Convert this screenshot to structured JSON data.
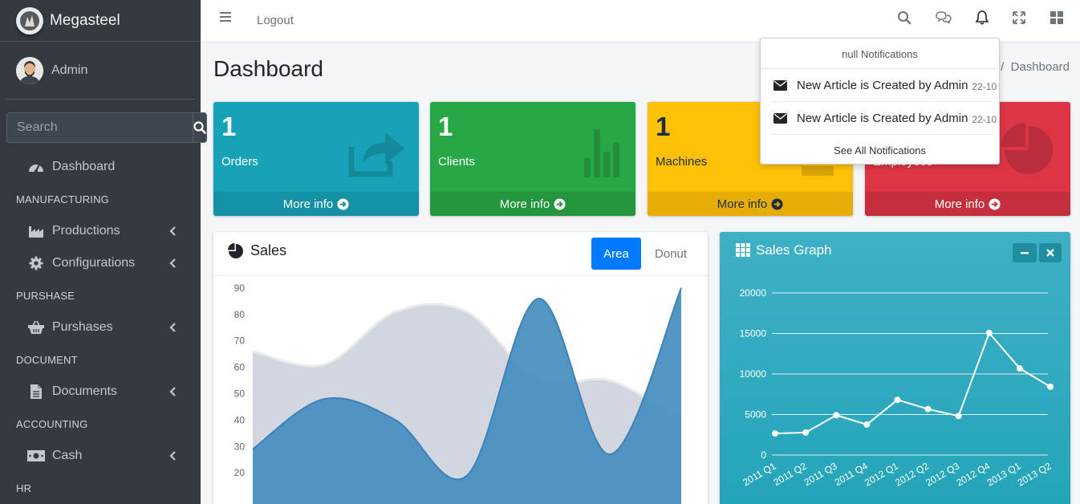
{
  "brand": {
    "name": "Megasteel"
  },
  "user": {
    "name": "Admin"
  },
  "sidebar": {
    "search_placeholder": "Search",
    "items": [
      {
        "type": "item",
        "label": "Dashboard",
        "icon": "tachometer-icon",
        "has_children": false
      },
      {
        "type": "header",
        "label": "MANUFACTURING"
      },
      {
        "type": "item",
        "label": "Productions",
        "icon": "industry-icon",
        "has_children": true
      },
      {
        "type": "item",
        "label": "Configurations",
        "icon": "gear-icon",
        "has_children": true
      },
      {
        "type": "header",
        "label": "PURSHASE"
      },
      {
        "type": "item",
        "label": "Purshases",
        "icon": "basket-icon",
        "has_children": true
      },
      {
        "type": "header",
        "label": "DOCUMENT"
      },
      {
        "type": "item",
        "label": "Documents",
        "icon": "file-icon",
        "has_children": true
      },
      {
        "type": "header",
        "label": "ACCOUNTING"
      },
      {
        "type": "item",
        "label": "Cash",
        "icon": "money-icon",
        "has_children": true
      },
      {
        "type": "header",
        "label": "HR"
      }
    ]
  },
  "topbar": {
    "logout_label": "Logout",
    "icons": [
      "menu-icon",
      "search-icon",
      "chat-icon",
      "bell-icon",
      "expand-icon",
      "apps-icon"
    ]
  },
  "page": {
    "title": "Dashboard",
    "breadcrumb": [
      "/",
      "Dashboard"
    ]
  },
  "notifications": {
    "header": "null Notifications",
    "items": [
      {
        "text": "New Article is Created by Admin",
        "time": "22-10",
        "icon": "envelope-icon"
      },
      {
        "text": "New Article is Created by Admin",
        "time": "22-10",
        "icon": "envelope-icon"
      }
    ],
    "footer": "See All Notifications"
  },
  "stat_boxes": [
    {
      "count": "1",
      "label": "Orders",
      "footer": "More info",
      "color": "#17a2b8",
      "icon": "share-icon"
    },
    {
      "count": "1",
      "label": "Clients",
      "footer": "More info",
      "color": "#28a745",
      "icon": "bar-chart-icon"
    },
    {
      "count": "1",
      "label": "Machines",
      "footer": "More info",
      "color": "#ffc107",
      "icon": "machine-icon"
    },
    {
      "count": "1",
      "label": "Employees",
      "footer": "More info",
      "color": "#dc3545",
      "icon": "pie-chart-icon"
    }
  ],
  "sales_card": {
    "title": "Sales",
    "tabs": [
      "Area",
      "Donut"
    ],
    "active_tab": "Area"
  },
  "graph_card": {
    "title": "Sales Graph"
  },
  "chart_data": [
    {
      "type": "area",
      "title": "Sales",
      "ylim": [
        15,
        92
      ],
      "yticks": [
        20,
        30,
        40,
        50,
        60,
        70,
        80,
        90
      ],
      "grid": false,
      "series": [
        {
          "color": "#d2d6de",
          "x": [
            0,
            1,
            2,
            3,
            4,
            5,
            6
          ],
          "values": [
            66,
            61,
            81,
            81,
            55,
            55,
            40
          ]
        },
        {
          "color": "#4a90c1",
          "x": [
            0,
            1,
            2,
            3,
            4,
            5,
            6
          ],
          "values": [
            29,
            48,
            40,
            19,
            86,
            27,
            90
          ]
        }
      ]
    },
    {
      "type": "line",
      "title": "Sales Graph",
      "categories": [
        "2011 Q1",
        "2011 Q2",
        "2011 Q3",
        "2011 Q4",
        "2012 Q1",
        "2012 Q2",
        "2012 Q3",
        "2012 Q4",
        "2013 Q1",
        "2013 Q2"
      ],
      "values": [
        2666,
        2778,
        4912,
        3767,
        6810,
        5670,
        4820,
        15073,
        10687,
        8432
      ],
      "ylim": [
        0,
        20000
      ],
      "yticks": [
        0,
        5000,
        10000,
        15000,
        20000
      ],
      "grid": true,
      "color": "#ffffff"
    }
  ]
}
